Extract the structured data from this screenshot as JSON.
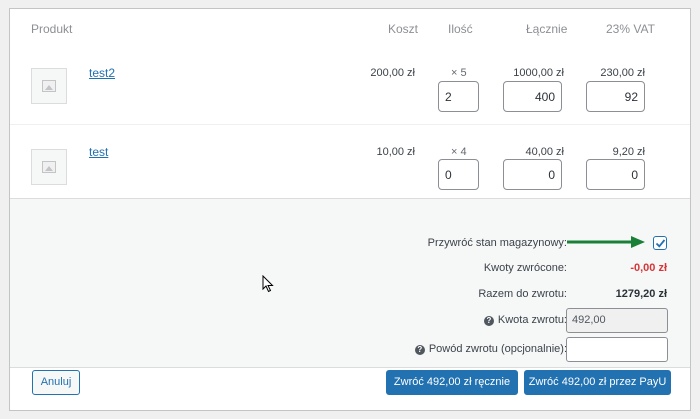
{
  "table": {
    "headers": {
      "product": "Produkt",
      "cost": "Koszt",
      "qty": "Ilość",
      "total": "Łącznie",
      "vat": "23% VAT"
    },
    "items": [
      {
        "name": "test2",
        "cost": "200,00 zł",
        "qty": "× 5",
        "total": "1000,00 zł",
        "vat": "230,00 zł",
        "refund_qty": "2",
        "refund_total": "400",
        "refund_vat": "92"
      },
      {
        "name": "test",
        "cost": "10,00 zł",
        "qty": "× 4",
        "total": "40,00 zł",
        "vat": "9,20 zł",
        "refund_qty": "0",
        "refund_total": "0",
        "refund_vat": "0"
      }
    ]
  },
  "refund": {
    "restock_label": "Przywróć stan magazynowy:",
    "restock_checked": true,
    "refunded_label": "Kwoty zwrócone:",
    "refunded_value": "-0,00 zł",
    "available_label": "Razem do zwrotu:",
    "available_value": "1279,20 zł",
    "amount_label": "Kwota zwrotu:",
    "amount_value": "492,00",
    "reason_label": "Powód zwrotu (opcjonalnie):",
    "reason_value": ""
  },
  "buttons": {
    "cancel": "Anuluj",
    "refund_manual": "Zwróć 492,00 zł ręcznie",
    "refund_payu": "Zwróć 492,00 zł przez PayU"
  },
  "colors": {
    "accent": "#2271b1",
    "arrow": "#1a7f37",
    "negative": "#d63638"
  },
  "icons": {
    "help": "question-circle-icon",
    "placeholder": "image-placeholder-icon",
    "checkbox": "checkmark-icon"
  }
}
